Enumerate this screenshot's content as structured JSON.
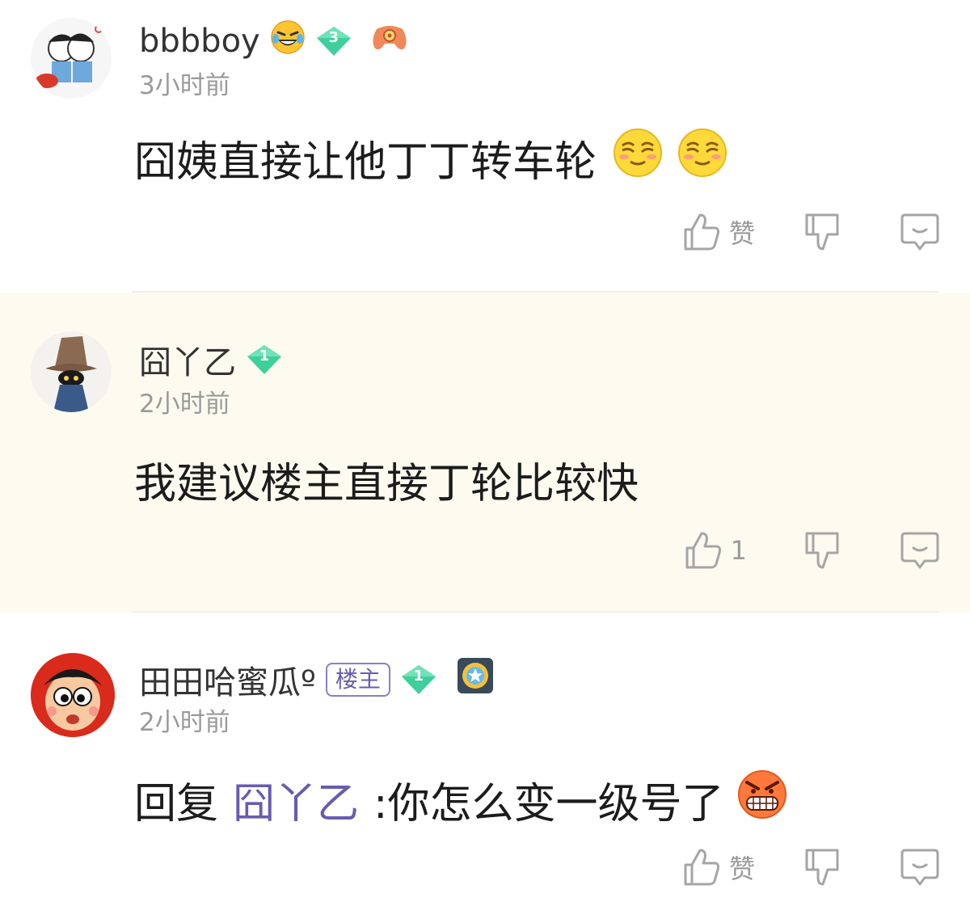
{
  "comments": [
    {
      "username": "bbbboy",
      "level": "3",
      "time": "3小时前",
      "text": "囧姨直接让他丁丁转车轮",
      "like_label": "赞"
    },
    {
      "username": "囧丫乙",
      "level": "1",
      "time": "2小时前",
      "text": "我建议楼主直接丁轮比较快",
      "like_label": "1"
    },
    {
      "username": "田田哈蜜瓜º",
      "host_badge": "楼主",
      "level": "1",
      "time": "2小时前",
      "reply_prefix": "回复",
      "mention": "囧丫乙",
      "text": ":你怎么变一级号了",
      "like_label": "赞"
    }
  ],
  "colors": {
    "highlight_bg": "#fdfbf0",
    "mention": "#6a5bb0",
    "level_gem": "#3ecf9a",
    "meta_gray": "#9a9a9a"
  }
}
